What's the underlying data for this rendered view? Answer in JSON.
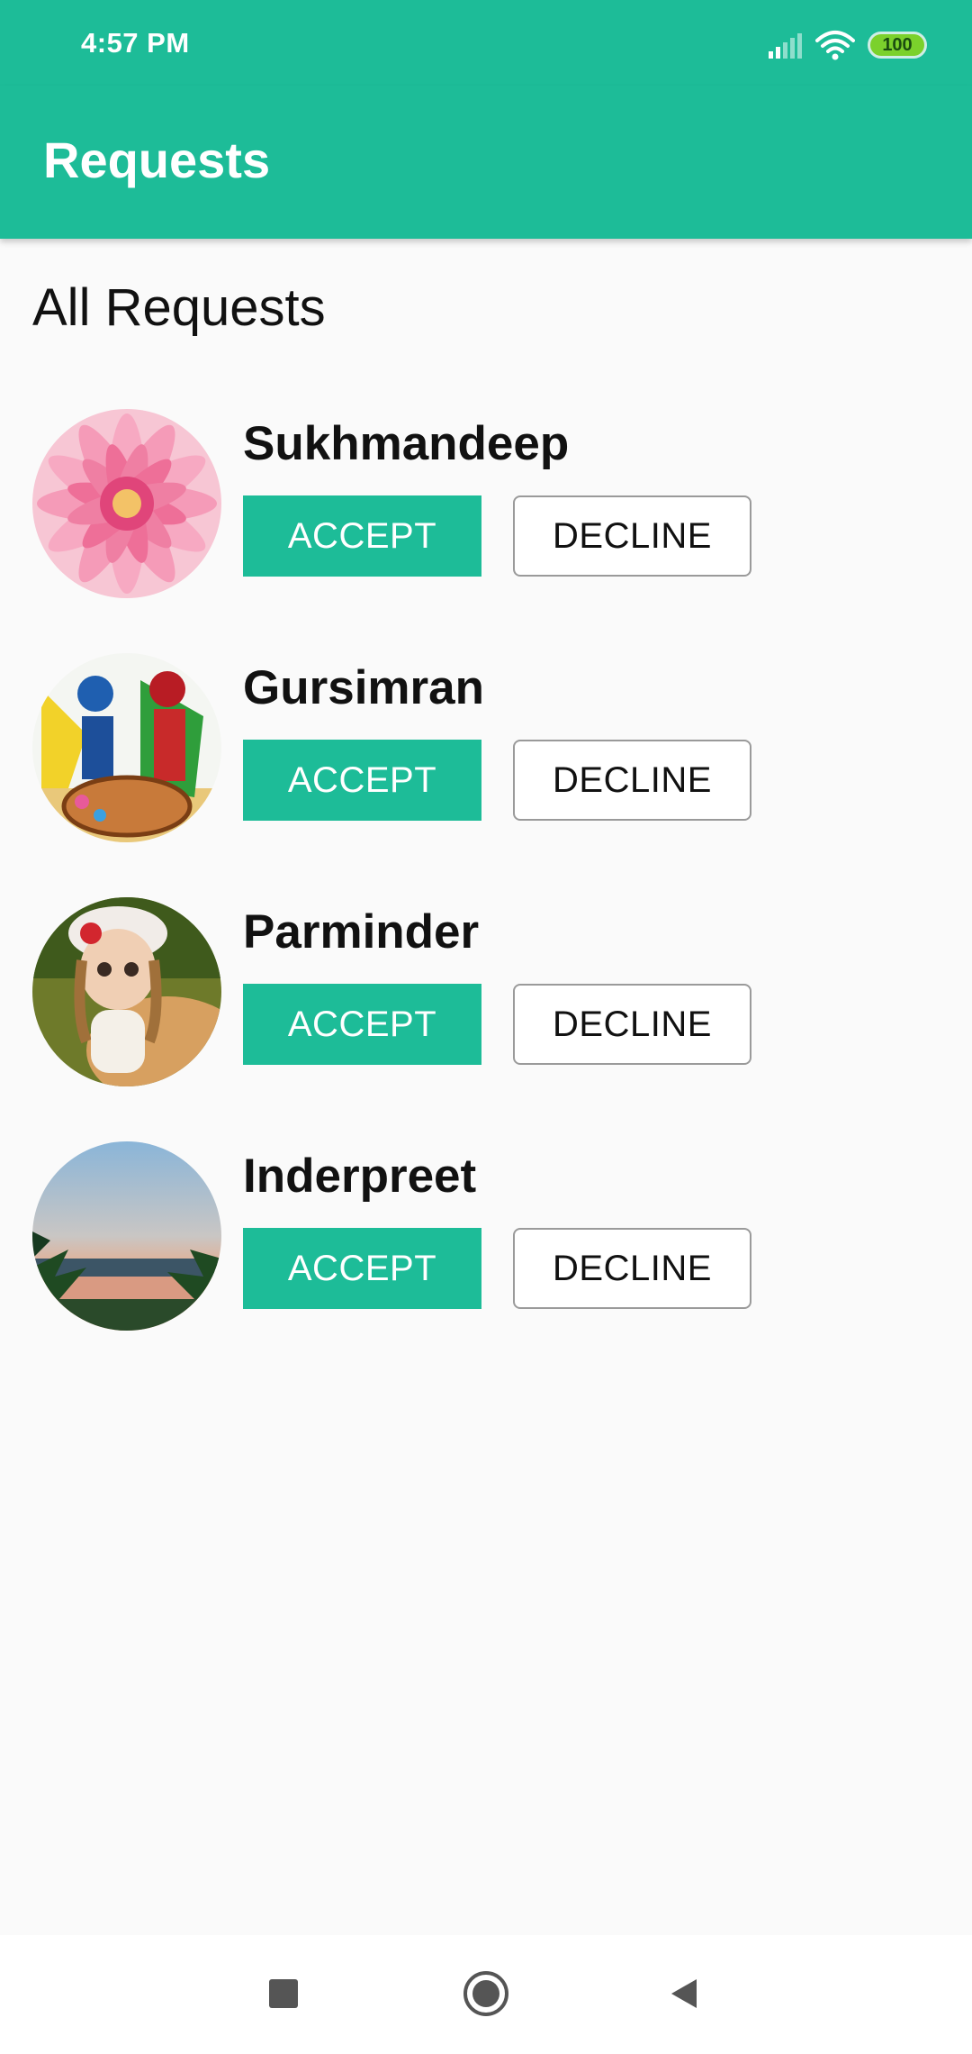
{
  "status_bar": {
    "time": "4:57 PM",
    "battery": "100"
  },
  "app_bar": {
    "title": "Requests"
  },
  "section": {
    "title": "All Requests"
  },
  "requests": [
    {
      "name": "Sukhmandeep",
      "accept_label": "ACCEPT",
      "decline_label": "DECLINE",
      "avatar": "pink-flower"
    },
    {
      "name": "Gursimran",
      "accept_label": "ACCEPT",
      "decline_label": "DECLINE",
      "avatar": "bhangra-dancers"
    },
    {
      "name": "Parminder",
      "accept_label": "ACCEPT",
      "decline_label": "DECLINE",
      "avatar": "doll"
    },
    {
      "name": "Inderpreet",
      "accept_label": "ACCEPT",
      "decline_label": "DECLINE",
      "avatar": "sunset-lake"
    }
  ],
  "nav_bar": {
    "icons": [
      "recents-square-icon",
      "home-circle-icon",
      "back-triangle-icon"
    ]
  },
  "colors": {
    "primary": "#1dbc98",
    "background": "#fafafa"
  }
}
